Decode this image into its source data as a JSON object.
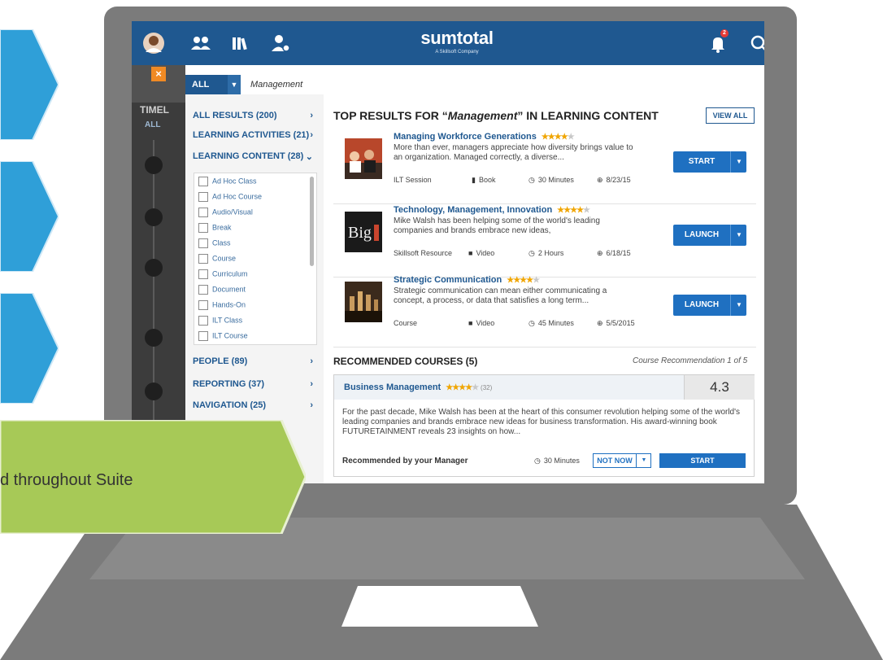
{
  "header": {
    "brand": "sumtotal",
    "brand_sub": "A Skillsoft Company",
    "notification_count": "2",
    "nav_icons": [
      "user-avatar",
      "people-icon",
      "library-icon",
      "settings-user-icon",
      "bell-icon",
      "search-icon"
    ]
  },
  "sidebar": {
    "close_label": "×",
    "timeline_label": "TIMEL",
    "all_label": "ALL"
  },
  "search": {
    "scope_label": "ALL",
    "query": "Management"
  },
  "filters": {
    "all_results": "ALL RESULTS (200)",
    "learning_activities": "LEARNING ACTIVITIES (21)",
    "learning_content": "LEARNING CONTENT (28)",
    "content_types": [
      "Ad Hoc Class",
      "Ad Hoc Course",
      "Audio/Visual",
      "Break",
      "Class",
      "Course",
      "Curriculum",
      "Document",
      "Hands-On",
      "ILT Class",
      "ILT Course"
    ],
    "people": "PEOPLE (89)",
    "reporting": "REPORTING (37)",
    "navigation": "NAVIGATION (25)"
  },
  "results": {
    "title_prefix": "TOP RESULTS FOR “",
    "title_query": "Management",
    "title_suffix": "” IN LEARNING CONTENT",
    "view_all": "VIEW ALL",
    "items": [
      {
        "title": "Managing Workforce Generations",
        "rating": 4,
        "description": "More than ever, managers appreciate how diversity brings value to an organization. Managed correctly, a diverse...",
        "type": "ILT Session",
        "format": "Book",
        "duration": "30 Minutes",
        "date": "8/23/15",
        "action": "START"
      },
      {
        "title": "Technology, Management, Innovation",
        "rating": 4,
        "description": "Mike Walsh has been helping some of the world's leading companies and brands embrace new ideas,",
        "type": "Skillsoft Resource",
        "format": "Video",
        "duration": "2 Hours",
        "date": "6/18/15",
        "action": "LAUNCH"
      },
      {
        "title": "Strategic Communication",
        "rating": 4,
        "description": "Strategic communication can mean either communicating a concept, a process, or data that satisfies a long term...",
        "type": "Course",
        "format": "Video",
        "duration": "45 Minutes",
        "date": "5/5/2015",
        "action": "LAUNCH"
      }
    ]
  },
  "recommended": {
    "title": "RECOMMENDED COURSES (5)",
    "subtitle": "Course Recommendation 1 of 5",
    "course_name": "Business Management",
    "rating": 4,
    "rating_count": "(32)",
    "score": "4.3",
    "description": "For the past decade, Mike Walsh has been at the heart of this consumer revolution helping some of the world's leading companies and brands embrace new ideas for business transformation. His award-winning book FUTURETAINMENT reveals 23 insights on how...",
    "recommended_by": "Recommended by your Manager",
    "duration": "30 Minutes",
    "not_now": "NOT NOW",
    "start": "START"
  },
  "banner": {
    "text": "d throughout Suite"
  },
  "colors": {
    "brand_blue": "#1f5890",
    "button_blue": "#1f70c1",
    "arrow_blue": "#2f9fd8",
    "banner_green": "#a7c957",
    "laptop_gray": "#7b7b7b",
    "star_gold": "#f0a500"
  }
}
